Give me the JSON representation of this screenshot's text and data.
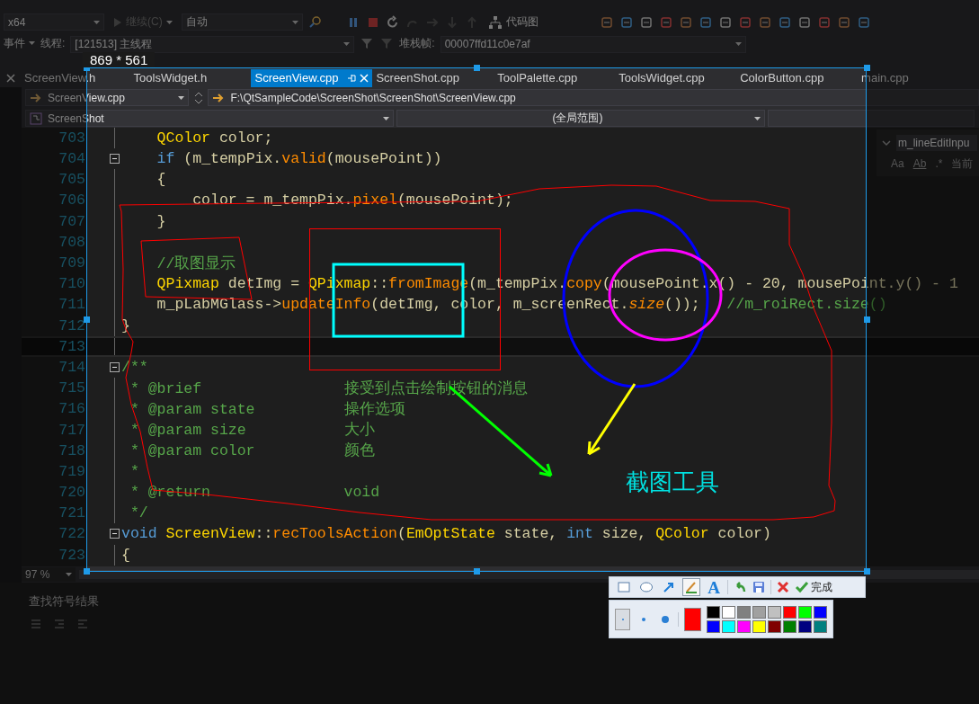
{
  "toolbar": {
    "platform": "x64",
    "continue_button": {
      "label": "继续(C)",
      "disabled": true
    },
    "mode": "自动",
    "code_map": "代码图"
  },
  "debug_bar": {
    "events": "事件",
    "thread_label": "线程:",
    "thread": "[121513] 主线程",
    "stack_label": "堆栈帧:",
    "stack_frame": "00007ffd11c0e7af"
  },
  "tabs": [
    {
      "label": "ScreenView.h",
      "selected": false
    },
    {
      "label": "ToolsWidget.h",
      "selected": false
    },
    {
      "label": "ScreenView.cpp",
      "selected": true
    },
    {
      "label": "ScreenShot.cpp",
      "selected": false
    },
    {
      "label": "ToolPalette.cpp",
      "selected": false
    },
    {
      "label": "ToolsWidget.cpp",
      "selected": false
    },
    {
      "label": "ColorButton.cpp",
      "selected": false
    },
    {
      "label": "main.cpp",
      "selected": false
    }
  ],
  "navigation": {
    "file": "ScreenView.cpp",
    "path": "F:\\QtSampleCode\\ScreenShot\\ScreenShot\\ScreenView.cpp",
    "project": "ScreenShot",
    "scope": "(全局范围)"
  },
  "code_lines": [
    {
      "number": "703",
      "fold_start": false,
      "current": false,
      "tokens": [
        {
          "kind": "type",
          "text": "    QColor"
        },
        {
          "kind": "text",
          "text": " color;"
        }
      ]
    },
    {
      "number": "704",
      "fold_start": true,
      "current": false,
      "tokens": [
        {
          "kind": "keyword",
          "text": "    if"
        },
        {
          "kind": "text",
          "text": " (m_tempPix."
        },
        {
          "kind": "call",
          "text": "valid"
        },
        {
          "kind": "text",
          "text": "(mousePoint))"
        }
      ]
    },
    {
      "number": "705",
      "fold_start": false,
      "current": false,
      "tokens": [
        {
          "kind": "text",
          "text": "    {"
        }
      ]
    },
    {
      "number": "706",
      "fold_start": false,
      "current": false,
      "tokens": [
        {
          "kind": "text",
          "text": "        color = m_tempPix."
        },
        {
          "kind": "call",
          "text": "pixel"
        },
        {
          "kind": "text",
          "text": "(mousePoint);"
        }
      ]
    },
    {
      "number": "707",
      "fold_start": false,
      "current": false,
      "tokens": [
        {
          "kind": "text",
          "text": "    }"
        }
      ]
    },
    {
      "number": "708",
      "fold_start": false,
      "current": false
    },
    {
      "number": "709",
      "fold_start": false,
      "current": false,
      "tokens": [
        {
          "kind": "comment",
          "text": "    //取图显示"
        }
      ]
    },
    {
      "number": "710",
      "fold_start": false,
      "current": false,
      "tokens": [
        {
          "kind": "type",
          "text": "    QPixmap"
        },
        {
          "kind": "text",
          "text": " detImg = "
        },
        {
          "kind": "type",
          "text": "QPixmap"
        },
        {
          "kind": "text",
          "text": "::"
        },
        {
          "kind": "call",
          "text": "fromImage"
        },
        {
          "kind": "text",
          "text": "(m_tempPix."
        },
        {
          "kind": "call",
          "text": "copy"
        },
        {
          "kind": "text",
          "text": "(mousePoint.x() - 20, mousePoint.y() - 1"
        }
      ]
    },
    {
      "number": "711",
      "fold_start": false,
      "current": false,
      "tokens": [
        {
          "kind": "text",
          "text": "    m_pLabMGlass->"
        },
        {
          "kind": "call",
          "text": "updateInfo"
        },
        {
          "kind": "text",
          "text": "(detImg, color, m_screenRect."
        },
        {
          "kind": "call_italic",
          "text": "size"
        },
        {
          "kind": "text",
          "text": "());   "
        },
        {
          "kind": "comment",
          "text": "//m_roiRect.size()"
        }
      ]
    },
    {
      "number": "712",
      "fold_start": false,
      "current": false,
      "tokens": [
        {
          "kind": "text",
          "text": "}"
        }
      ]
    },
    {
      "number": "713",
      "fold_start": false,
      "current": true
    },
    {
      "number": "714",
      "fold_start": true,
      "current": false,
      "tokens": [
        {
          "kind": "comment",
          "text": "/**"
        }
      ]
    },
    {
      "number": "715",
      "fold_start": false,
      "current": false,
      "tokens": [
        {
          "kind": "comment",
          "text": " * @brief                接受到点击绘制按钮的消息"
        }
      ]
    },
    {
      "number": "716",
      "fold_start": false,
      "current": false,
      "tokens": [
        {
          "kind": "comment",
          "text": " * @param state          操作选项"
        }
      ]
    },
    {
      "number": "717",
      "fold_start": false,
      "current": false,
      "tokens": [
        {
          "kind": "comment",
          "text": " * @param size           大小"
        }
      ]
    },
    {
      "number": "718",
      "fold_start": false,
      "current": false,
      "tokens": [
        {
          "kind": "comment",
          "text": " * @param color          颜色"
        }
      ]
    },
    {
      "number": "719",
      "fold_start": false,
      "current": false,
      "tokens": [
        {
          "kind": "comment",
          "text": " *"
        }
      ]
    },
    {
      "number": "720",
      "fold_start": false,
      "current": false,
      "tokens": [
        {
          "kind": "comment",
          "text": " * @return               void"
        }
      ]
    },
    {
      "number": "721",
      "fold_start": false,
      "current": false,
      "tokens": [
        {
          "kind": "comment",
          "text": " */"
        }
      ]
    },
    {
      "number": "722",
      "fold_start": true,
      "current": false,
      "tokens": [
        {
          "kind": "keyword",
          "text": "void"
        },
        {
          "kind": "type",
          "text": " ScreenView"
        },
        {
          "kind": "text",
          "text": "::"
        },
        {
          "kind": "call",
          "text": "recToolsAction"
        },
        {
          "kind": "text",
          "text": "("
        },
        {
          "kind": "type",
          "text": "EmOptState"
        },
        {
          "kind": "text",
          "text": " state, "
        },
        {
          "kind": "keyword",
          "text": "int"
        },
        {
          "kind": "text",
          "text": " size, "
        },
        {
          "kind": "type",
          "text": "QColor"
        },
        {
          "kind": "text",
          "text": " color)"
        }
      ]
    },
    {
      "number": "723",
      "fold_start": false,
      "current": false,
      "tokens": [
        {
          "kind": "text",
          "text": "{"
        }
      ]
    }
  ],
  "find_panel": {
    "value": "m_lineEditInpu",
    "options": [
      "Aa",
      "Ab",
      ".*"
    ],
    "scope": "当前"
  },
  "zoom": "97 %",
  "bottom_panel": {
    "title": "查找符号结果"
  },
  "capture": {
    "size_label": "869 * 561",
    "marks": [
      {
        "kind": "freehand",
        "color": "#ff0000"
      },
      {
        "kind": "freehand",
        "color": "#ff0000"
      },
      {
        "kind": "rect",
        "color": "#ff0000"
      },
      {
        "kind": "rect",
        "color": "#00ffff"
      },
      {
        "kind": "ellipse",
        "color": "#0000ff"
      },
      {
        "kind": "ellipse",
        "color": "#ff00ff"
      },
      {
        "kind": "arrow",
        "color": "#00ff00"
      },
      {
        "kind": "arrow",
        "color": "#ffff00"
      },
      {
        "kind": "text",
        "color": "#00e0e0",
        "text": "截图工具"
      }
    ],
    "tools": [
      {
        "kind": "rect",
        "selected": false
      },
      {
        "kind": "ellipse",
        "selected": false
      },
      {
        "kind": "arrow",
        "selected": false
      },
      {
        "kind": "brush",
        "selected": true
      },
      {
        "kind": "text",
        "label": "A",
        "selected": false
      }
    ],
    "actions": [
      {
        "kind": "undo"
      },
      {
        "kind": "save"
      },
      {
        "kind": "cancel"
      },
      {
        "kind": "done",
        "label": "完成"
      }
    ],
    "pen_sizes": [
      {
        "kind": "small",
        "selected": true
      },
      {
        "kind": "medium",
        "selected": false
      },
      {
        "kind": "large",
        "selected": false
      }
    ],
    "current": {
      "color": "#ff0000"
    },
    "swatches": [
      {
        "color": "#000000"
      },
      {
        "color": "#ffffff"
      },
      {
        "color": "#808080"
      },
      {
        "color": "#a0a0a0"
      },
      {
        "color": "#c0c0c0"
      },
      {
        "color": "#ff0000"
      },
      {
        "color": "#00ff00"
      },
      {
        "color": "#0000ff"
      },
      {
        "color": "#0000ff"
      },
      {
        "color": "#00ffff"
      },
      {
        "color": "#ff00ff"
      },
      {
        "color": "#ffff00"
      },
      {
        "color": "#800000"
      },
      {
        "color": "#008000"
      },
      {
        "color": "#000080"
      },
      {
        "color": "#008080"
      }
    ]
  }
}
